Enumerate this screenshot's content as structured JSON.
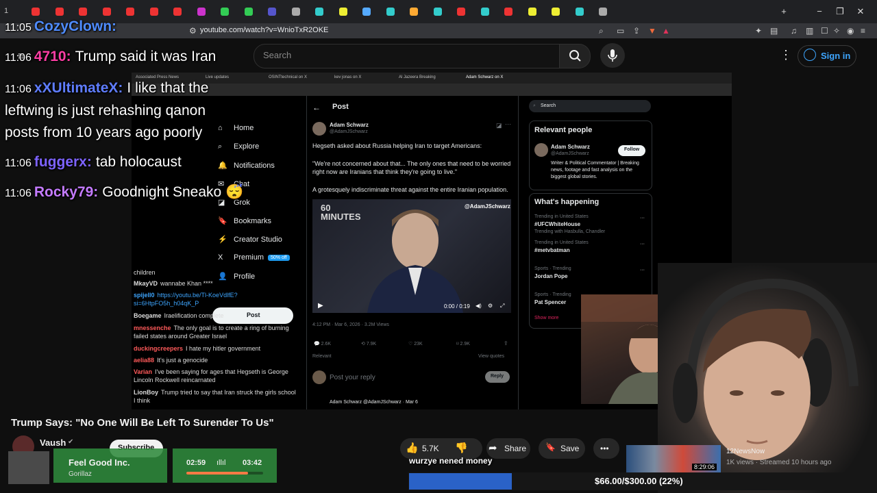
{
  "browser": {
    "tab_counter": "1",
    "url": "youtube.com/watch?v=WnioTxR2OKE",
    "window_controls": {
      "minimize": "−",
      "maximize": "❐",
      "close": "✕"
    },
    "new_tab": "+"
  },
  "youtube": {
    "search_placeholder": "Search",
    "sign_in_label": "Sign in",
    "video_title": "Trump Says: \"No One Will Be Left To Surender To Us\"",
    "channel_name": "Vaush",
    "subscribe_label": "Subscribe",
    "likes": "5.7K",
    "share_label": "Share",
    "save_label": "Save",
    "more_label": "•••",
    "recommended": {
      "channel": "12NewsNow",
      "meta": "1K views · Streamed 10 hours ago",
      "duration": "8:29:06"
    }
  },
  "chat_overlay": [
    {
      "time": "11:05",
      "user": "CozyClown:",
      "message": "",
      "color": "#4f8cff"
    },
    {
      "time": "11:06",
      "user": "4710:",
      "message": "Trump said it was Iran",
      "color": "#ff3ea5"
    },
    {
      "time": "11:06",
      "user": "xXUltimateX:",
      "message": "I like that the",
      "color": "#5f7dff"
    },
    {
      "time": "",
      "user": "",
      "message": "leftwing is just rehashing qanon",
      "color": "#ffffff"
    },
    {
      "time": "",
      "user": "",
      "message": "posts from 10 years ago poorly",
      "color": "#ffffff"
    },
    {
      "time": "11:06",
      "user": "fuggerx:",
      "message": "tab holocaust",
      "color": "#7d63ff"
    },
    {
      "time": "11:06",
      "user": "Rocky79:",
      "message": "Goodnight Sneako 😴",
      "color": "#c47bff"
    }
  ],
  "embedded": {
    "x_nav": [
      {
        "icon": "⌂",
        "label": "Home"
      },
      {
        "icon": "⌕",
        "label": "Explore"
      },
      {
        "icon": "🔔",
        "label": "Notifications"
      },
      {
        "icon": "✉",
        "label": "Chat"
      },
      {
        "icon": "◪",
        "label": "Grok"
      },
      {
        "icon": "🔖",
        "label": "Bookmarks"
      },
      {
        "icon": "⚡",
        "label": "Creator Studio"
      },
      {
        "icon": "X",
        "label": "Premium"
      },
      {
        "icon": "👤",
        "label": "Profile"
      }
    ],
    "premium_badge": "50% off",
    "post_button": "Post",
    "post_header": "Post",
    "author_name": "Adam Schwarz",
    "author_handle": "@AdamJSchwarz",
    "tweet_lines": [
      "Hegseth asked about Russia helping Iran to target Americans:",
      "\"We're not concerned about that... The only ones that need to be worried",
      "right now are Iranians that think they're going to live.\"",
      "A grotesquely indiscriminate threat against the entire Iranian population."
    ],
    "video_watermark": "@AdamJSchwarz",
    "video_logo": "60 MINUTES",
    "video_time": "0:00 / 0:19",
    "tweet_meta": "4:12 PM · Mar 6, 2026 · 3.2M Views",
    "reply_counts": {
      "replies": "2.6K",
      "reposts": "7.9K",
      "likes": "23K",
      "bookmarks": "2.9K"
    },
    "relevant_label": "Relevant",
    "view_quotes": "View quotes",
    "reply_placeholder": "Post your reply",
    "reply_button": "Reply",
    "next_author": "Adam Schwarz @AdamJSchwarz · Mar 6",
    "search_placeholder": "Search",
    "relevant_people_title": "Relevant people",
    "follow_label": "Follow",
    "person_bio": "Writer & Political Commentator | Breaking news, footage and fast analysis on the biggest global stories.",
    "whats_happening_title": "What's happening",
    "trends": [
      {
        "context": "Trending in United States",
        "tag": "#UFCWhiteHouse",
        "extra": "Trending with Hasbulla, Chandler"
      },
      {
        "context": "Trending in United States",
        "tag": "#metvbatman",
        "extra": ""
      },
      {
        "context": "Sports · Trending",
        "tag": "Jordan Pope",
        "extra": ""
      },
      {
        "context": "Sports · Trending",
        "tag": "Pat Spencer",
        "extra": ""
      }
    ],
    "show_more": "Show more",
    "twitch_chat": [
      {
        "user": "",
        "message": "children",
        "color": "#dddddd"
      },
      {
        "user": "MkayVD",
        "message": "wannabe Khan ****",
        "color": "#dddddd"
      },
      {
        "user": "spijell0",
        "message": "https://youtu.be/Tl-KoeVdlfE? si=6HtpFO5h_h04qK_P",
        "color": "#3ea6ff"
      },
      {
        "user": "Boegame",
        "message": "Iraelification complete",
        "color": "#dddddd"
      },
      {
        "user": "mnessenche",
        "message": "The only goal is to create a ring of burning failed states around Greater Israel",
        "color": "#ff5a5a"
      },
      {
        "user": "duckingcreepers",
        "message": "I hate my hitler government",
        "color": "#ff5a5a"
      },
      {
        "user": "aelia88",
        "message": "It's just a genocide",
        "color": "#ff5a5a"
      },
      {
        "user": "Varian",
        "message": "I've been saying for ages that Hegseth is George Lincoln Rockwell reincarnated",
        "color": "#ff5a5a"
      },
      {
        "user": "LionBoy",
        "message": "Trump tried to say that Iran struck the girls school I think",
        "color": "#dddddd"
      }
    ]
  },
  "overlay_widgets": {
    "song_title": "Feel Good Inc.",
    "song_artist": "Gorillaz",
    "time_elapsed": "02:59",
    "time_total": "03:42",
    "progress_fraction": 0.8,
    "donation_name": "wurzye nened money",
    "donation_goal": "$66.00/$300.00 (22%)",
    "donation_fraction": 0.22
  }
}
